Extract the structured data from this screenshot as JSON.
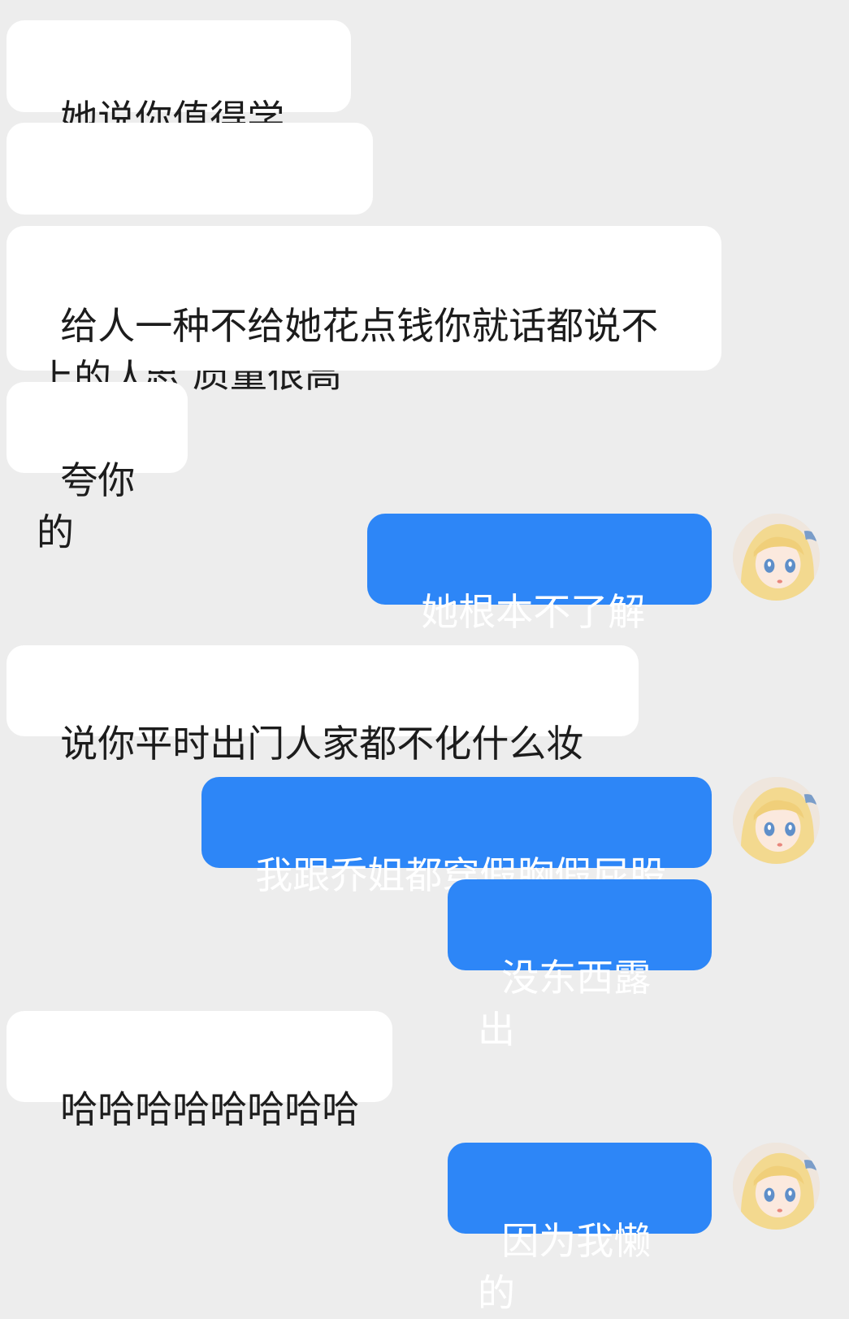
{
  "messages": [
    {
      "id": "m1",
      "side": "in",
      "text": "她说你值得学习"
    },
    {
      "id": "m2",
      "side": "in",
      "text": "思 质量很高",
      "redacted_prefix": true
    },
    {
      "id": "m3",
      "side": "in",
      "text": "给人一种不给她花点钱你就话都说不上的人"
    },
    {
      "id": "m4",
      "side": "in",
      "text": "夸你的"
    },
    {
      "id": "m5",
      "side": "out",
      "text": "她根本不了解我"
    },
    {
      "id": "m6",
      "side": "in",
      "text": "说你平时出门人家都不化什么妆"
    },
    {
      "id": "m7",
      "side": "out",
      "text": "我跟乔姐都穿假胸假屁股"
    },
    {
      "id": "m8",
      "side": "out",
      "text": "没东西露出"
    },
    {
      "id": "m9",
      "side": "in",
      "text": "哈哈哈哈哈哈哈哈"
    },
    {
      "id": "m10",
      "side": "out",
      "text": "因为我懒的"
    }
  ],
  "colors": {
    "background": "#ededed",
    "incoming_bubble": "#ffffff",
    "outgoing_bubble": "#2d86f7"
  },
  "avatar_icon": "anime-girl-avatar"
}
